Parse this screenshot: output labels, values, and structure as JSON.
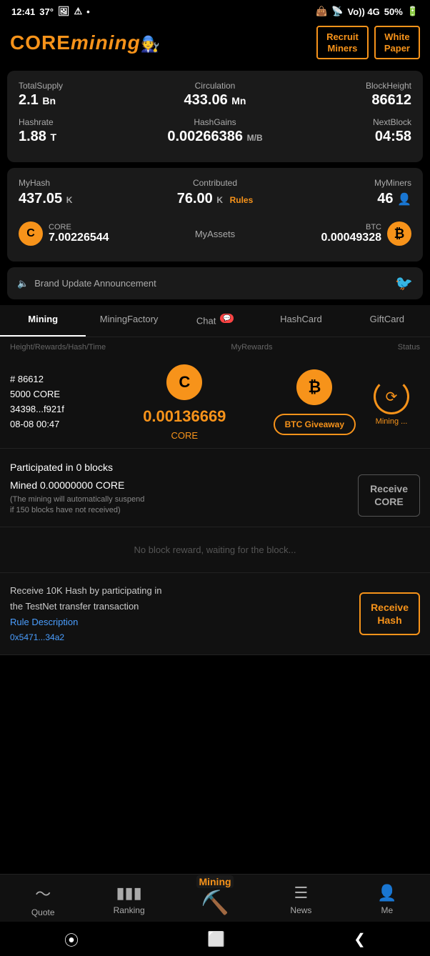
{
  "statusBar": {
    "time": "12:41",
    "degree": "37°",
    "batteryPercent": "50%"
  },
  "header": {
    "logoText": "CORE mining",
    "recruitMinersLabel": "Recruit\nMiners",
    "whitePaperLabel": "White\nPaper"
  },
  "stats": {
    "totalSupplyLabel": "TotalSupply",
    "totalSupplyValue": "2.1",
    "totalSupplyUnit": "Bn",
    "circulationLabel": "Circulation",
    "circulationValue": "433.06",
    "circulationUnit": "Mn",
    "blockHeightLabel": "BlockHeight",
    "blockHeightValue": "86612",
    "hashrateLabel": "Hashrate",
    "hashrateValue": "1.88",
    "hashrateUnit": "T",
    "hashGainsLabel": "HashGains",
    "hashGainsValue": "0.00266386",
    "hashGainsUnit": "M/B",
    "nextBlockLabel": "NextBlock",
    "nextBlockValue": "04:58"
  },
  "myStats": {
    "myHashLabel": "MyHash",
    "myHashValue": "437.05",
    "myHashUnit": "K",
    "contributedLabel": "Contributed",
    "contributedValue": "76.00",
    "contributedUnit": "K",
    "rulesLabel": "Rules",
    "myMinersLabel": "MyMiners",
    "myMinersValue": "46"
  },
  "assets": {
    "coreCoin": "C",
    "coreLabel": "CORE",
    "coreValue": "7.00226544",
    "myAssetsLabel": "MyAssets",
    "btcLabel": "BTC",
    "btcValue": "0.00049328"
  },
  "announcement": {
    "speakerIcon": "🔈",
    "text": "Brand Update Announcement",
    "twitterIcon": "🐦"
  },
  "tabs": [
    {
      "label": "Mining",
      "active": true,
      "badge": ""
    },
    {
      "label": "MiningFactory",
      "active": false,
      "badge": ""
    },
    {
      "label": "Chat",
      "active": false,
      "badge": "💬"
    },
    {
      "label": "HashCard",
      "active": false,
      "badge": ""
    },
    {
      "label": "GiftCard",
      "active": false,
      "badge": ""
    }
  ],
  "tableHeader": {
    "col1": "Height/Rewards/Hash/Time",
    "col2": "MyRewards",
    "col3": "Status"
  },
  "miningRow": {
    "blockNum": "# 86612",
    "rewards": "5000 CORE",
    "hash": "34398...f921f",
    "time": "08-08 00:47",
    "coreAmount": "0.00136669",
    "coreLabel": "CORE",
    "btcGiveawayLabel": "BTC Giveaway",
    "statusLabel": "Mining ..."
  },
  "participated": {
    "line1": "Participated in 0 blocks",
    "line2": "Mined 0.00000000 CORE",
    "note": "(The mining will automatically suspend\nif 150 blocks have not received)",
    "btnLabel": "Receive\nCORE"
  },
  "noReward": {
    "message": "No block reward, waiting for the block..."
  },
  "receiveHash": {
    "line1": "Receive 10K Hash by participating in",
    "line2": "the TestNet transfer transaction",
    "ruleLabel": "Rule Description",
    "hashAddr": "0x5471...34a2",
    "btnLabel": "Receive\nHash"
  },
  "bottomNav": {
    "items": [
      {
        "icon": "📈",
        "label": "Quote",
        "active": false
      },
      {
        "icon": "📊",
        "label": "Ranking",
        "active": false
      },
      {
        "icon": "⛏️",
        "label": "Mining",
        "active": true,
        "isMining": true
      },
      {
        "icon": "📰",
        "label": "News",
        "active": false
      },
      {
        "icon": "👤",
        "label": "Me",
        "active": false
      }
    ]
  },
  "androidNav": {
    "back": "❮",
    "home": "⬜",
    "recent": "⦿"
  }
}
